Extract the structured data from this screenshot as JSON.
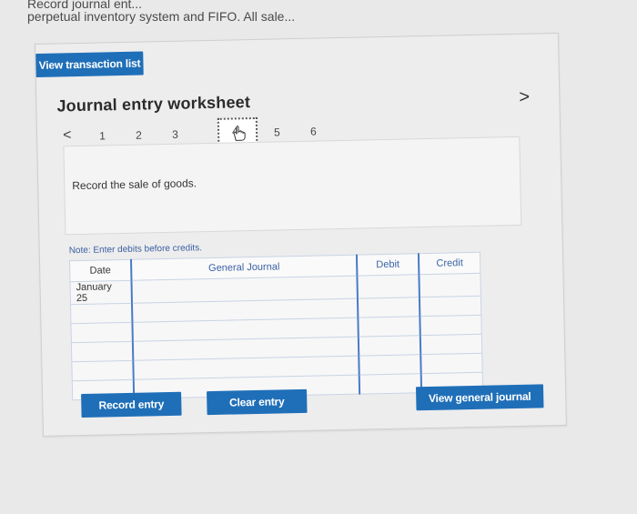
{
  "header": {
    "line1": "Record journal ent...",
    "line2": "perpetual inventory system and FIFO. All sale..."
  },
  "buttons": {
    "view_transaction_list": "View transaction list",
    "record_entry": "Record entry",
    "clear_entry": "Clear entry",
    "view_general_journal": "View general journal"
  },
  "worksheet": {
    "title": "Journal entry worksheet",
    "prev_label": "<",
    "next_label": ">",
    "steps": [
      "1",
      "2",
      "3",
      "4",
      "5",
      "6"
    ],
    "active_step": "4",
    "prompt": "Record the sale of goods."
  },
  "note": "Note: Enter debits before credits.",
  "table": {
    "headers": [
      "Date",
      "General Journal",
      "Debit",
      "Credit"
    ],
    "rows": [
      [
        "January 25",
        "",
        "",
        ""
      ],
      [
        "",
        "",
        "",
        ""
      ],
      [
        "",
        "",
        "",
        ""
      ],
      [
        "",
        "",
        "",
        ""
      ],
      [
        "",
        "",
        "",
        ""
      ],
      [
        "",
        "",
        "",
        ""
      ]
    ]
  },
  "colors": {
    "button_blue": "#1f6fb8",
    "page_bg": "#e9e9ea"
  }
}
